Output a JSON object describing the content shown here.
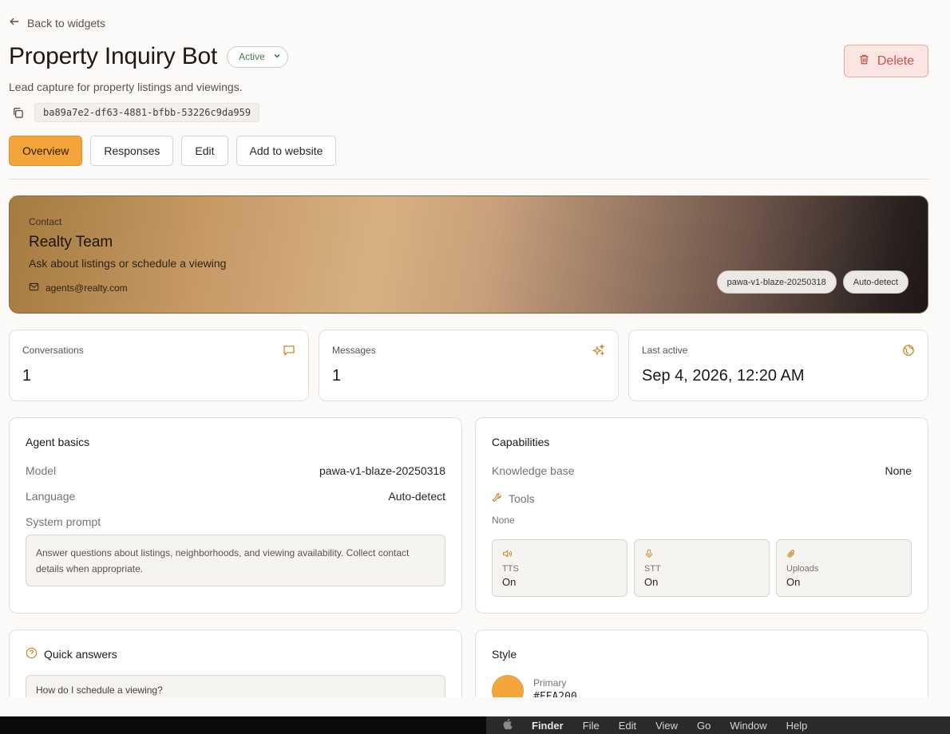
{
  "nav": {
    "back_label": "Back to widgets"
  },
  "header": {
    "title": "Property Inquiry Bot",
    "status": "Active",
    "subtitle": "Lead capture for property listings and viewings.",
    "widget_id": "ba89a7e2-df63-4881-bfbb-53226c9da959",
    "delete_label": "Delete"
  },
  "tabs": [
    {
      "label": "Overview",
      "active": true
    },
    {
      "label": "Responses",
      "active": false
    },
    {
      "label": "Edit",
      "active": false
    },
    {
      "label": "Add to website",
      "active": false
    }
  ],
  "hero": {
    "contact_label": "Contact",
    "name": "Realty Team",
    "tagline": "Ask about listings or schedule a viewing",
    "email": "agents@realty.com",
    "chips": [
      "pawa-v1-blaze-20250318",
      "Auto-detect"
    ]
  },
  "stats": [
    {
      "label": "Conversations",
      "value": "1",
      "icon": "chat-icon"
    },
    {
      "label": "Messages",
      "value": "1",
      "icon": "sparkles-icon"
    },
    {
      "label": "Last active",
      "value": "Sep 4, 2026, 12:20 AM",
      "icon": "globe-icon"
    }
  ],
  "agent_basics": {
    "title": "Agent basics",
    "model_label": "Model",
    "model_value": "pawa-v1-blaze-20250318",
    "language_label": "Language",
    "language_value": "Auto-detect",
    "prompt_label": "System prompt",
    "prompt_text": "Answer questions about listings, neighborhoods, and viewing availability. Collect contact details when appropriate."
  },
  "capabilities": {
    "title": "Capabilities",
    "kb_label": "Knowledge base",
    "kb_value": "None",
    "tools_label": "Tools",
    "tools_value": "None",
    "items": [
      {
        "label": "TTS",
        "value": "On",
        "icon": "speaker-icon"
      },
      {
        "label": "STT",
        "value": "On",
        "icon": "microphone-icon"
      },
      {
        "label": "Uploads",
        "value": "On",
        "icon": "paperclip-icon"
      }
    ]
  },
  "quick_answers": {
    "title": "Quick answers",
    "items": [
      "How do I schedule a viewing?"
    ]
  },
  "style": {
    "title": "Style",
    "primary_label": "Primary",
    "primary_value": "#FFA200",
    "primary_color": "#f3a43b"
  },
  "menubar": {
    "app": "Finder",
    "items": [
      "File",
      "Edit",
      "View",
      "Go",
      "Window",
      "Help"
    ]
  },
  "colors": {
    "accent": "#f3a43b",
    "danger": "#d0504a",
    "status_green": "#3f7d52"
  }
}
